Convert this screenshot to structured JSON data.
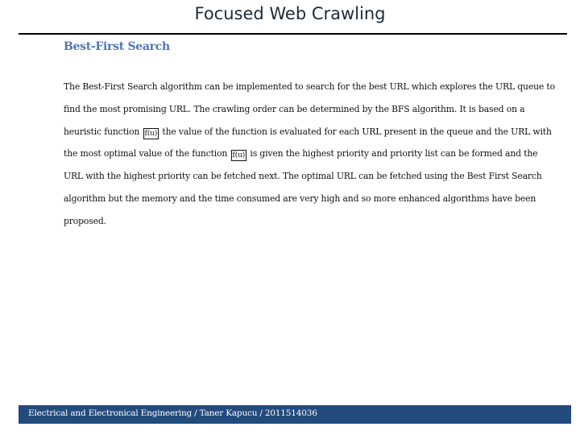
{
  "slide": {
    "title": "Focused Web Crawling",
    "heading": "Best-First Search",
    "paragraph": {
      "part1": "The Best-First Search algorithm can be implemented to search for the best URL which explores the URL queue to find the most promising URL. The crawling order can be determined by the BFS algorithm. It is based on a heuristic function",
      "symbol1": "f(u)",
      "part2": "the value of the function is evaluated for each URL present in the queue and the URL with the most optimal value of the function",
      "symbol2": "f(u)",
      "part3": "is given the highest priority and priority list can be formed and the URL with the highest priority can be fetched next. The optimal URL can be fetched using the Best First Search algorithm but the memory and the time consumed are very high and so more enhanced algorithms have been proposed."
    },
    "footer": "Electrical and Electronical Engineering / Taner Kapucu / 2011514036"
  },
  "colors": {
    "heading": "#4f77b0",
    "footer_bg": "#234a7c",
    "footer_text": "#ffffff"
  }
}
